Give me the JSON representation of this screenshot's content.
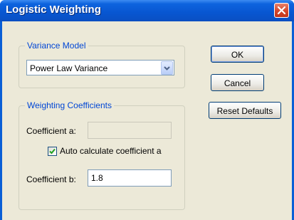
{
  "window": {
    "title": "Logistic Weighting"
  },
  "variance_model": {
    "legend": "Variance Model",
    "selected": "Power Law Variance"
  },
  "weighting_coefficients": {
    "legend": "Weighting Coefficients",
    "coefficient_a_label": "Coefficient a:",
    "coefficient_a_value": "",
    "auto_calc_label": "Auto calculate coefficient a",
    "auto_calc_checked": true,
    "coefficient_b_label": "Coefficient b:",
    "coefficient_b_value": "1.8"
  },
  "buttons": {
    "ok": "OK",
    "cancel": "Cancel",
    "reset": "Reset Defaults"
  },
  "colors": {
    "title_bar": "#0a5fd6",
    "legend_text": "#0046d5",
    "dialog_bg": "#ece9d8",
    "close_button": "#d4452a"
  },
  "icons": {
    "close": "close-icon",
    "dropdown": "chevron-down-icon",
    "check": "checkmark-icon"
  }
}
